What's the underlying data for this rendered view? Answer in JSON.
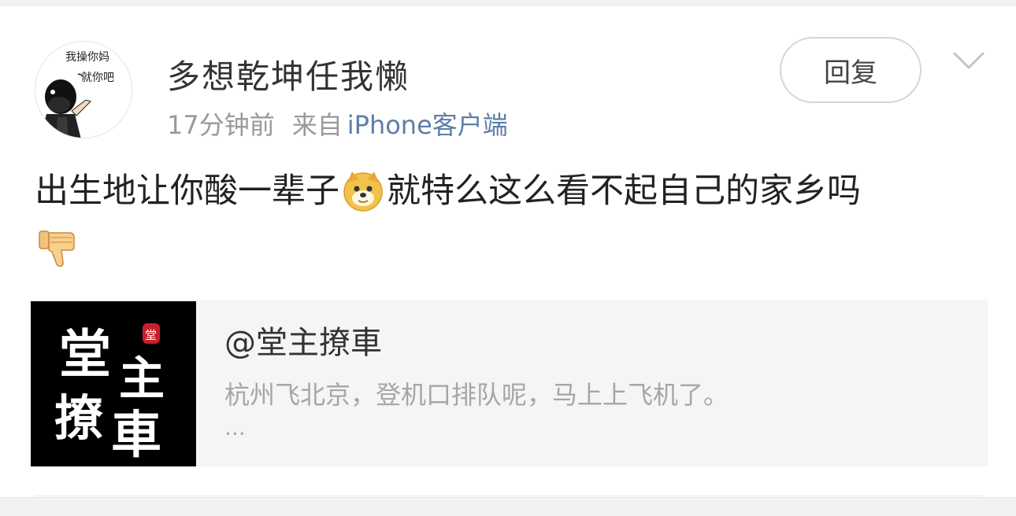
{
  "comment": {
    "username": "多想乾坤任我懒",
    "time": "17分钟前",
    "source_prefix": "来自",
    "source_client": "iPhone客户端",
    "reply_label": "回复",
    "text_part1": "出生地让你酸一辈子",
    "text_part2": "就特么这么看不起自己的家乡吗",
    "emojis": [
      "doge-emoji",
      "thumbs-down-emoji"
    ]
  },
  "avatar": {
    "line1": "我操你妈",
    "line2": "就你吧"
  },
  "quoted_post": {
    "user": "@堂主撩車",
    "body": "杭州飞北京，登机口排队呢，马上上飞机了。",
    "ellipsis": "...",
    "thumb_text": [
      "堂",
      "主",
      "撩",
      "車"
    ],
    "thumb_seal": "堂"
  },
  "colors": {
    "link": "#5b7ea8",
    "meta": "#999999",
    "text": "#222222",
    "card_bg": "#f5f5f5",
    "seal": "#c8202a"
  }
}
